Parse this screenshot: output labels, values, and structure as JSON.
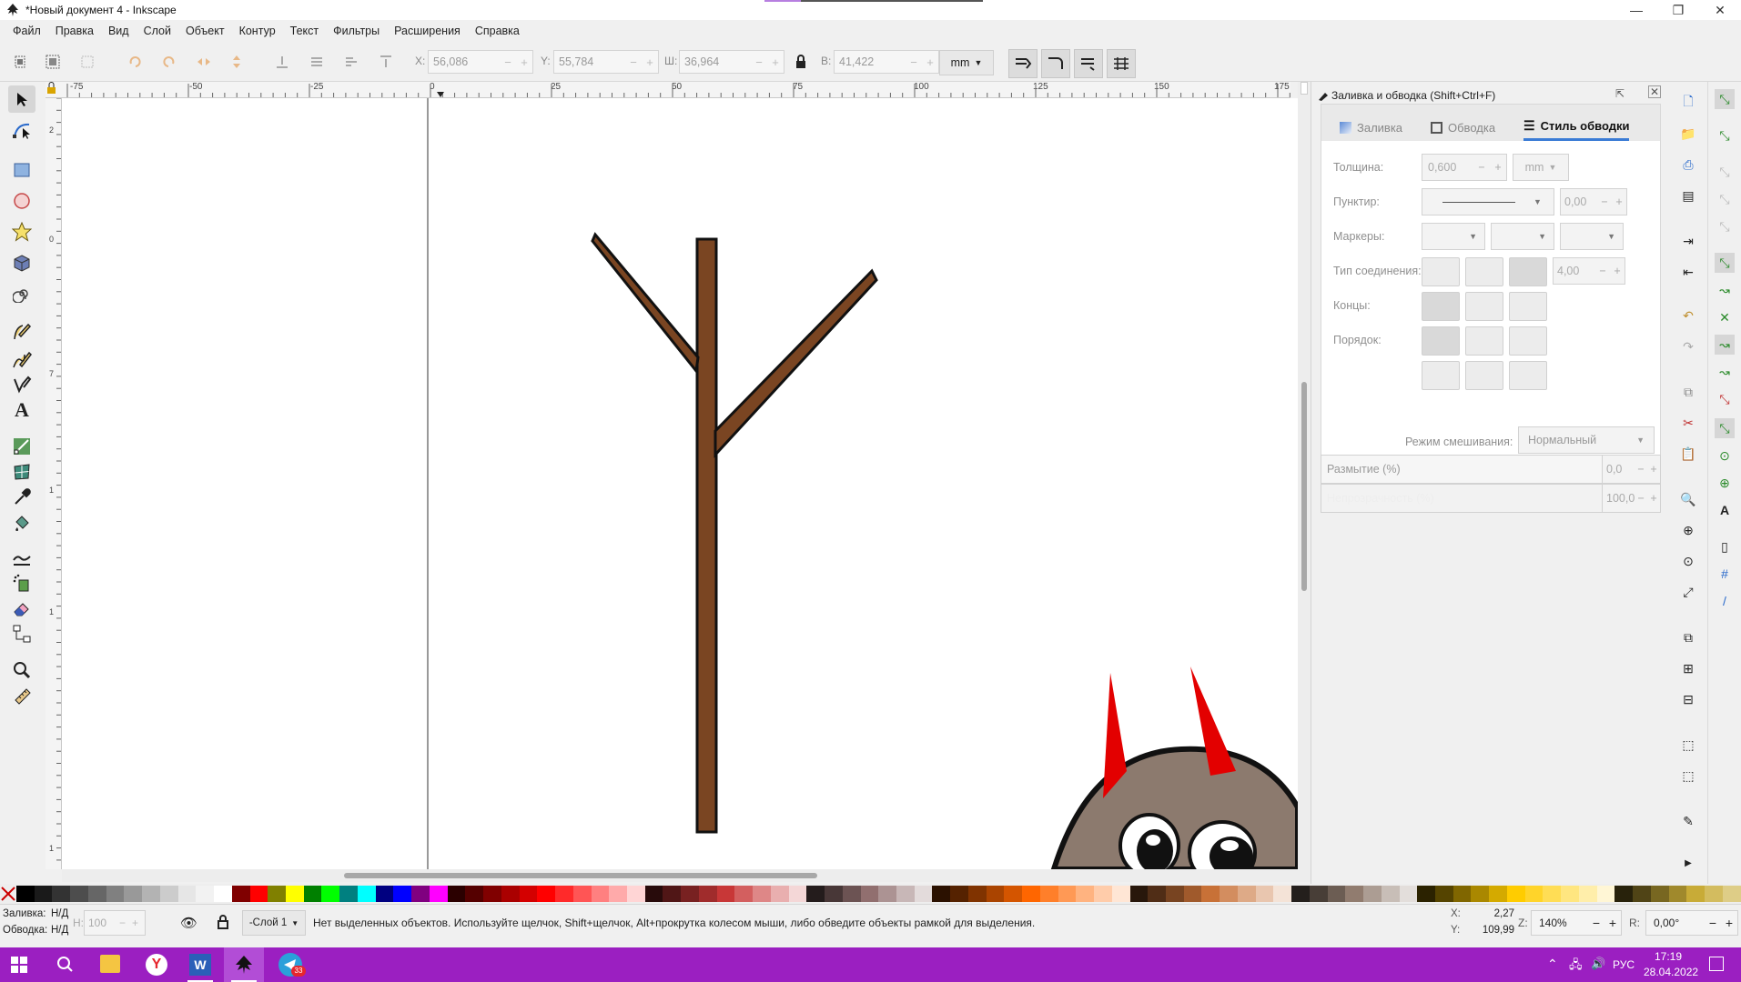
{
  "window": {
    "title": "*Новый документ 4 - Inkscape",
    "controls": [
      "—",
      "❐",
      "✕"
    ]
  },
  "menu": [
    "Файл",
    "Правка",
    "Вид",
    "Слой",
    "Объект",
    "Контур",
    "Текст",
    "Фильтры",
    "Расширения",
    "Справка"
  ],
  "toolbar": {
    "x_label": "X:",
    "x_value": "56,086",
    "y_label": "Y:",
    "y_value": "55,784",
    "w_label": "Ш:",
    "w_value": "36,964",
    "h_label": "В:",
    "h_value": "41,422",
    "unit": "mm"
  },
  "ruler_top": [
    "-75",
    "-50",
    "-25",
    "0",
    "25",
    "50",
    "75",
    "100",
    "125",
    "150",
    "175"
  ],
  "ruler_left": [
    "2",
    "5",
    "0",
    "7",
    "1",
    "5",
    "0",
    "1",
    "2",
    "5",
    "1",
    "5",
    "0"
  ],
  "canvas": {
    "branch_fill": "#7a4522",
    "branch_stroke": "#111111",
    "creature_body": "#8c7a6e",
    "creature_horn": "#e30000"
  },
  "dialog": {
    "title": "Заливка и обводка (Shift+Ctrl+F)",
    "tabs": [
      "Заливка",
      "Обводка",
      "Стиль обводки"
    ],
    "width_label": "Толщина:",
    "width_value": "0,600",
    "width_unit": "mm",
    "dash_label": "Пунктир:",
    "dash_offset": "0,00",
    "markers_label": "Маркеры:",
    "join_label": "Тип соединения:",
    "miter_value": "4,00",
    "cap_label": "Концы:",
    "order_label": "Порядок:",
    "blend_label": "Режим смешивания:",
    "blend_value": "Нормальный",
    "blur_label": "Размытие (%)",
    "blur_value": "0,0",
    "opacity_label": "Непрозрачность (%)",
    "opacity_value": "100,0"
  },
  "status": {
    "fill_label": "Заливка:",
    "fill_value": "Н/Д",
    "stroke_label": "Обводка:",
    "stroke_value": "Н/Д",
    "opacity_label": "Н:",
    "opacity_value": "100",
    "layer": "-Слой 1",
    "message": "Нет выделенных объектов. Используйте щелчок, Shift+щелчок, Alt+прокрутка колесом мыши, либо обведите объекты рамкой для выделения.",
    "x_label": "X:",
    "x_value": "2,27",
    "y_label": "Y:",
    "y_value": "109,99",
    "zoom_label": "Z:",
    "zoom_value": "140%",
    "rot_label": "R:",
    "rot_value": "0,00°"
  },
  "taskbar": {
    "language": "РУС",
    "time": "17:19",
    "date": "28.04.2022",
    "telegram_badge": "33"
  },
  "palette": [
    "#000000",
    "#1a1a1a",
    "#333333",
    "#4d4d4d",
    "#666666",
    "#808080",
    "#999999",
    "#b3b3b3",
    "#cccccc",
    "#e6e6e6",
    "#f2f2f2",
    "#ffffff",
    "#800000",
    "#ff0000",
    "#808000",
    "#ffff00",
    "#008000",
    "#00ff00",
    "#008080",
    "#00ffff",
    "#000080",
    "#0000ff",
    "#800080",
    "#ff00ff",
    "#2b0000",
    "#550000",
    "#800000",
    "#aa0000",
    "#d40000",
    "#ff0000",
    "#ff2a2a",
    "#ff5555",
    "#ff8080",
    "#ffaaaa",
    "#ffd5d5",
    "#280b0b",
    "#501616",
    "#782121",
    "#a02c2c",
    "#c83737",
    "#d35f5f",
    "#de8787",
    "#e9afaf",
    "#f4d7d7",
    "#241c1c",
    "#483737",
    "#6c5353",
    "#916f6f",
    "#ac9393",
    "#c8b7b7",
    "#e3dbdb",
    "#2b1100",
    "#552200",
    "#803300",
    "#aa4400",
    "#d45500",
    "#ff6600",
    "#ff7f2a",
    "#ff9955",
    "#ffb380",
    "#ffccaa",
    "#ffe6d5",
    "#28170b",
    "#502d16",
    "#784421",
    "#a05a2c",
    "#c87137",
    "#d38d5f",
    "#deaa87",
    "#e9c6af",
    "#f4e3d7",
    "#241f1c",
    "#483e37",
    "#6c5d53",
    "#917c6f",
    "#ac9d93",
    "#c8beb7",
    "#e3dedb",
    "#2b2200",
    "#554400",
    "#806600",
    "#aa8800",
    "#d4aa00",
    "#ffcc00",
    "#ffd42a",
    "#ffdd55",
    "#ffe680",
    "#ffeeaa",
    "#fff6d5",
    "#28220b",
    "#504416",
    "#786721",
    "#a0892c",
    "#c8ab37",
    "#d3bc5f",
    "#decd87"
  ]
}
